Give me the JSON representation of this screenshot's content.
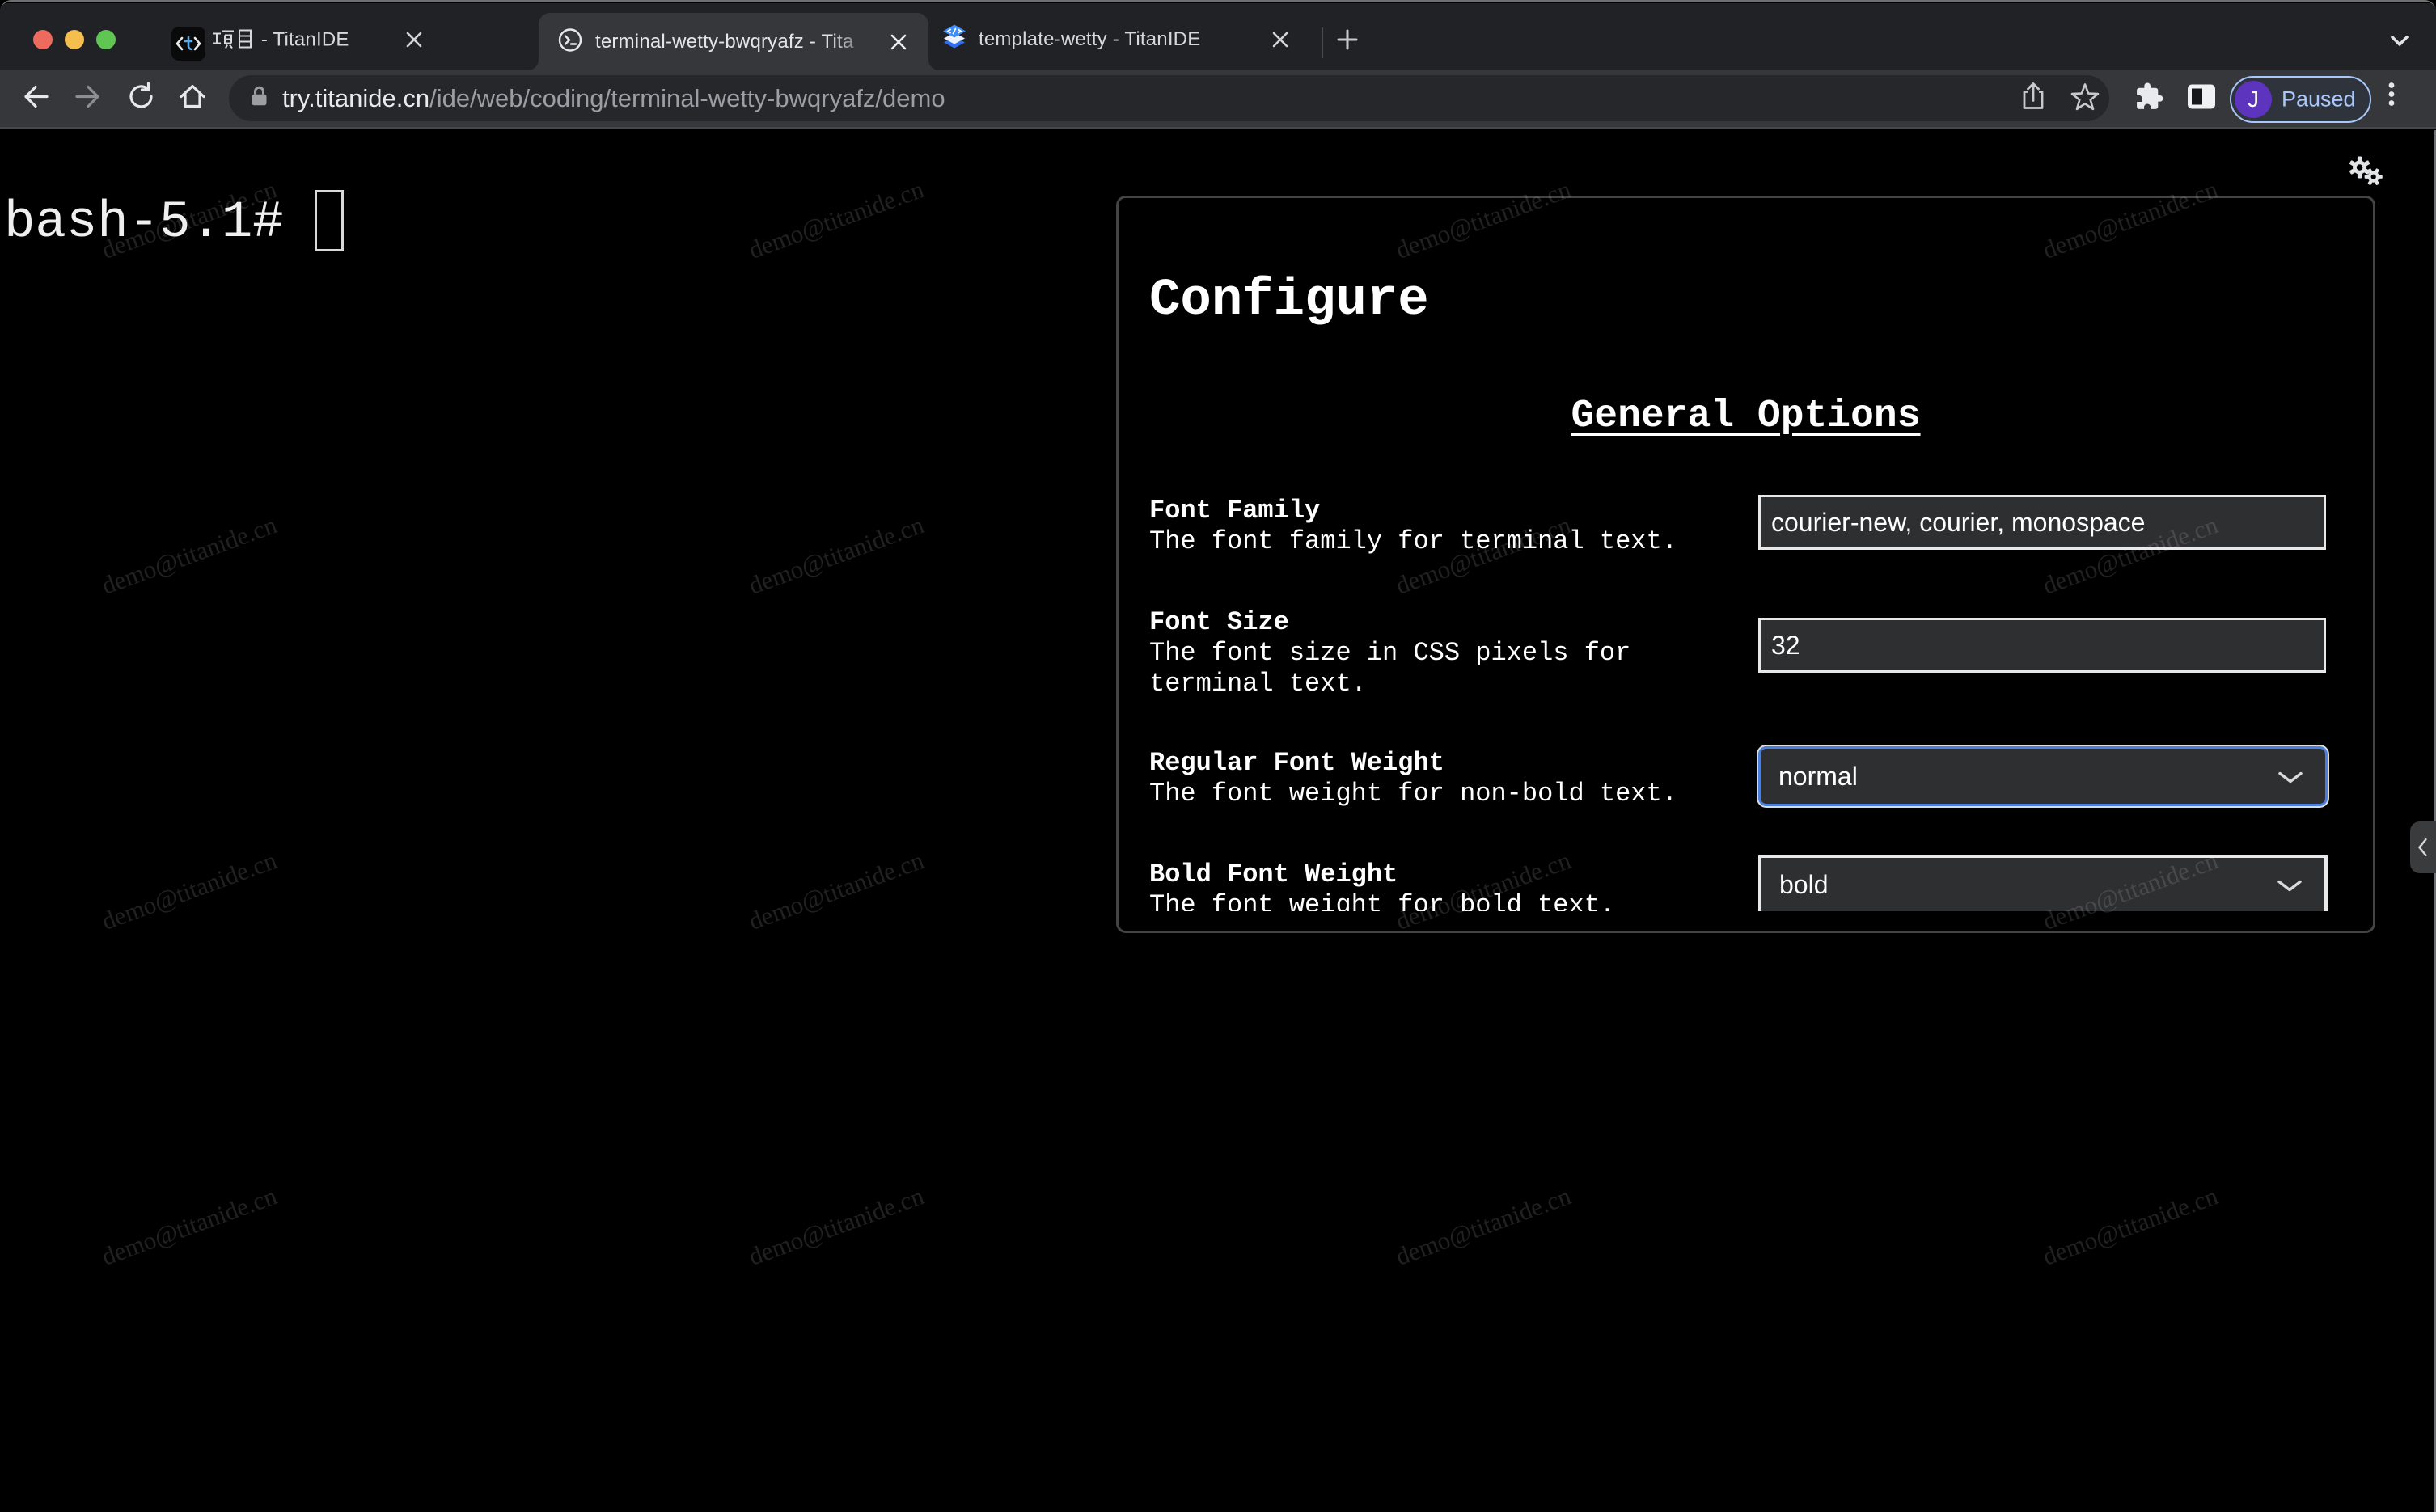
{
  "browser": {
    "window_controls": {
      "close": "traffic-red",
      "minimize": "traffic-yellow",
      "maximize": "traffic-green"
    },
    "tabs": [
      {
        "title": "项目 - TitanIDE",
        "title_latin_part": " - TitanIDE",
        "icon": "titanide-code-icon",
        "active": false
      },
      {
        "title": "terminal-wetty-bwqryafz - Tita",
        "icon": "terminal-prompt-icon",
        "active": true
      },
      {
        "title": "template-wetty - TitanIDE",
        "icon": "template-layers-icon",
        "active": false
      }
    ],
    "toolbar": {
      "url_host": "try.titanide.cn",
      "url_path": "/ide/web/coding/terminal-wetty-bwqryafz/demo",
      "profile": {
        "avatar_initial": "J",
        "status_label": "Paused"
      }
    }
  },
  "page": {
    "terminal": {
      "prompt_line": "bash-5.1# "
    },
    "watermark": {
      "text": "demo@titanide.cn"
    },
    "dialog": {
      "title": "Configure",
      "section_heading": "General Options",
      "rows": [
        {
          "label": "Font Family",
          "description": "The font family for terminal text.",
          "control": "text-input",
          "value": "courier-new, courier, monospace"
        },
        {
          "label": "Font Size",
          "description": "The font size in CSS pixels for terminal text.",
          "control": "text-input",
          "value": "32"
        },
        {
          "label": "Regular Font Weight",
          "description": "The font weight for non-bold text.",
          "control": "select",
          "value": "normal",
          "focused": true
        },
        {
          "label": "Bold Font Weight",
          "description": "The font weight for bold text.",
          "control": "select",
          "value": "bold",
          "focused": false
        }
      ]
    }
  },
  "colors": {
    "page_background": "#000000",
    "tabstrip_background": "#212226",
    "toolbar_background": "#35373b",
    "accent_focus_blue": "#4a7fe0",
    "profile_accent_blue": "#a8c7fa",
    "avatar_purple": "#5d34bd",
    "traffic_red": "#ed6a5e",
    "traffic_yellow": "#f4bf4f",
    "traffic_green": "#61c554"
  }
}
